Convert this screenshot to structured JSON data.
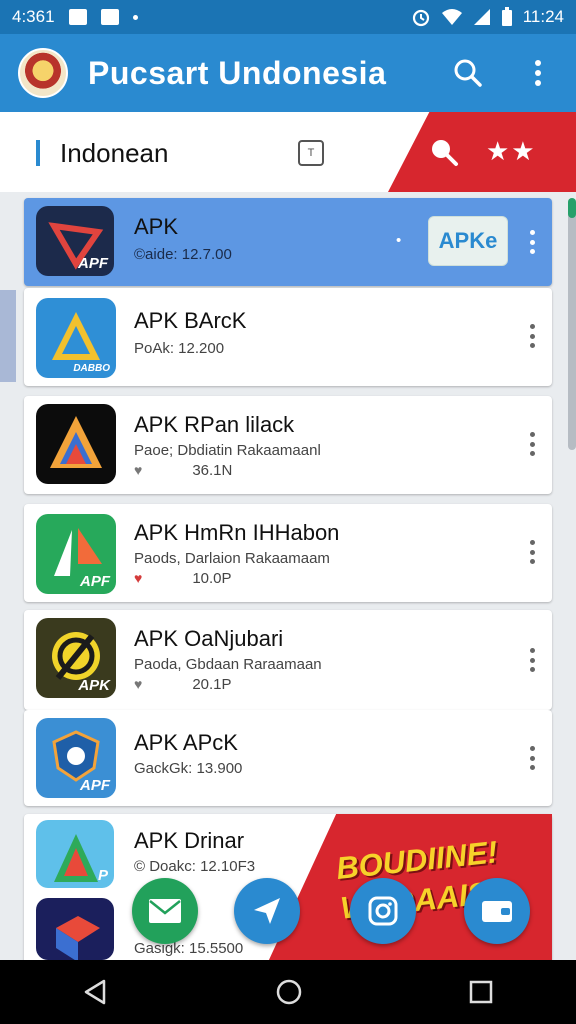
{
  "status_bar": {
    "time_left": "4:361",
    "time_right": "11:24",
    "icons": [
      "notification-icon",
      "image-icon",
      "dot-icon",
      "alarm-icon",
      "wifi-icon",
      "signal-icon",
      "battery-icon"
    ]
  },
  "app_bar": {
    "title": "Pucsart Undonesia",
    "icons": [
      "emblem-logo",
      "search-icon",
      "more-vert-icon"
    ],
    "color": "#2a8ad0"
  },
  "sub_header": {
    "title": "Indonean",
    "button_glyph": "T",
    "banner_color": "#d7262e",
    "banner_stars": "★★"
  },
  "apps": [
    {
      "name": "APK",
      "detail": "©aide: 12.7.00",
      "size": "",
      "icon_tag": "APF",
      "button_label": "APKe",
      "selected": true
    },
    {
      "name": "APK BArcK",
      "detail": "PoAk: 12.200",
      "size": "",
      "icon_tag": "DABBO"
    },
    {
      "name": "APK RPan lilack",
      "detail": "Paoe; Dbdiatin Rakaamaanl",
      "size": "36.1N",
      "icon_tag": ""
    },
    {
      "name": "APK HmRn IHHabon",
      "detail": "Paods, Darlaion Rakaamaam",
      "size": "10.0P",
      "icon_tag": "APF"
    },
    {
      "name": "APK OaNjubari",
      "detail": "Paoda, Gbdaan Raraamaan",
      "size": "20.1P",
      "icon_tag": "APK"
    },
    {
      "name": "APK APcK",
      "detail": "GackGk: 13.900",
      "size": "",
      "icon_tag": "APF"
    },
    {
      "name": "APK Drinar",
      "detail": "© Doakc: 12.10F3",
      "size": "",
      "icon_tag": "P"
    },
    {
      "name": "",
      "detail": "Gasigk: 15.5500",
      "size": "",
      "icon_tag": ""
    }
  ],
  "promo": {
    "text": "BOUDIINE! WAOAAIS",
    "color": "#d7262e"
  },
  "fab_buttons": [
    "mail-icon",
    "send-icon",
    "instagram-icon",
    "wallet-icon"
  ],
  "nav_bar": [
    "back-icon",
    "home-icon",
    "recents-icon"
  ]
}
